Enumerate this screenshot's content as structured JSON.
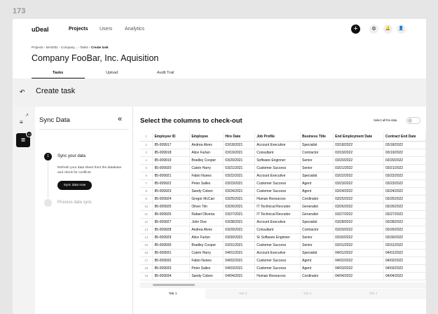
{
  "frame_number": "173",
  "app": {
    "logo": "uDeal",
    "nav": [
      "Projects",
      "Users",
      "Analytics"
    ],
    "actions": {
      "add": "+",
      "settings": "⚙",
      "notifications": "🔔",
      "profile": "👤"
    }
  },
  "header": {
    "breadcrumb": [
      "Projects",
      "MA0001 - Company...",
      "Tasks",
      "Create task"
    ],
    "breadcrumb_sep": "›",
    "title": "Company FooBar, Inc. Aquisition",
    "tabs": [
      "Tasks",
      "Upload",
      "Audit Trail"
    ]
  },
  "create_task": {
    "title": "Create task"
  },
  "steps": {
    "title": "Sync Data",
    "collapse": "«",
    "step1": {
      "num": "1",
      "label": "Sync your data",
      "desc": "Refresh your data sheet from the database and check for conflicts.",
      "button": "Sync data now"
    },
    "step2": {
      "num": "2",
      "label": "Process data sync"
    },
    "rail_badge": "13"
  },
  "main": {
    "title": "Select the columns to check-out",
    "select_all": "Select all the data"
  },
  "table": {
    "columns": [
      "Employee ID",
      "Employee",
      "Hire Date",
      "Job Profile",
      "Business Title",
      "End Employment Date",
      "Contract End Date"
    ],
    "rows": [
      [
        "85-009917",
        "Andrea Alves",
        "03/18/2021",
        "Account Executive",
        "Specialist",
        "03/18/2022",
        "03/18/2022"
      ],
      [
        "85-009918",
        "Alice Furlan",
        "03/19/2021",
        "Consultant",
        "Contractor",
        "03/19/2022",
        "03/19/2022"
      ],
      [
        "85-009919",
        "Bradley Cooper",
        "03/20/2021",
        "Software Enginner",
        "Senior",
        "03/20/2022",
        "03/20/2022"
      ],
      [
        "85-009920",
        "Calvin Harry",
        "03/21/2021",
        "Customer Success",
        "Senior",
        "03/21/2022",
        "03/21/2022"
      ],
      [
        "85-009921",
        "Fabio Nunes",
        "03/22/2021",
        "Account Executive",
        "Specialist",
        "03/22/2022",
        "03/22/2022"
      ],
      [
        "85-009922",
        "Peter Salles",
        "03/23/2021",
        "Customer Success",
        "Agent",
        "03/23/2022",
        "03/23/2022"
      ],
      [
        "85-009923",
        "Sandy Coben",
        "03/24/2021",
        "Customer Success",
        "Agent",
        "03/24/2022",
        "03/24/2022"
      ],
      [
        "85-009924",
        "Gregor McCan",
        "03/25/2021",
        "Human Resources",
        "Cordinator",
        "03/25/2022",
        "03/25/2022"
      ],
      [
        "85-009925",
        "Oliver Tim",
        "03/26/2021",
        "IT Technical Recruiter",
        "Generalist",
        "03/26/2022",
        "03/26/2022"
      ],
      [
        "85-009926",
        "Rafael Oliveira",
        "03/27/2021",
        "IT Technical Recruiter",
        "Generalist",
        "03/27/2022",
        "03/27/2022"
      ],
      [
        "85-009927",
        "John Doe",
        "03/28/2021",
        "Account Executive",
        "Specialist",
        "03/28/2022",
        "03/28/2022"
      ],
      [
        "85-009928",
        "Andrea Alves",
        "03/29/2021",
        "Consultant",
        "Contractor",
        "03/29/2022",
        "03/29/2022"
      ],
      [
        "85-009929",
        "Alice Furlan",
        "03/30/2021",
        "Sr Software Enginner",
        "Senior",
        "03/30/2022",
        "03/30/2022"
      ],
      [
        "85-009930",
        "Bradley Cooper",
        "03/31/2021",
        "Customer Success",
        "Senior",
        "03/31/2022",
        "03/31/2022"
      ],
      [
        "85-009931",
        "Calvin Harry",
        "04/01/2021",
        "Account Executive",
        "Specialist",
        "04/01/2022",
        "04/01/2022"
      ],
      [
        "85-009932",
        "Fabio Nunes",
        "04/02/2021",
        "Customer Success",
        "Agent",
        "04/02/2022",
        "04/02/2022"
      ],
      [
        "85-009933",
        "Peter Salles",
        "04/03/2021",
        "Customer Success",
        "Agent",
        "04/03/2022",
        "04/03/2022"
      ],
      [
        "85-009934",
        "Sandy Coben",
        "04/04/2021",
        "Human Resources",
        "Cordinator",
        "04/04/2022",
        "04/04/2022"
      ]
    ]
  },
  "sheet_tabs": [
    "Tab 1",
    "Tab 2",
    "Tab 3",
    "Tab 4"
  ],
  "colors": {
    "accent": "#111111",
    "panel_bg": "#f1f1f1",
    "page_bg": "#e6e6e6"
  }
}
